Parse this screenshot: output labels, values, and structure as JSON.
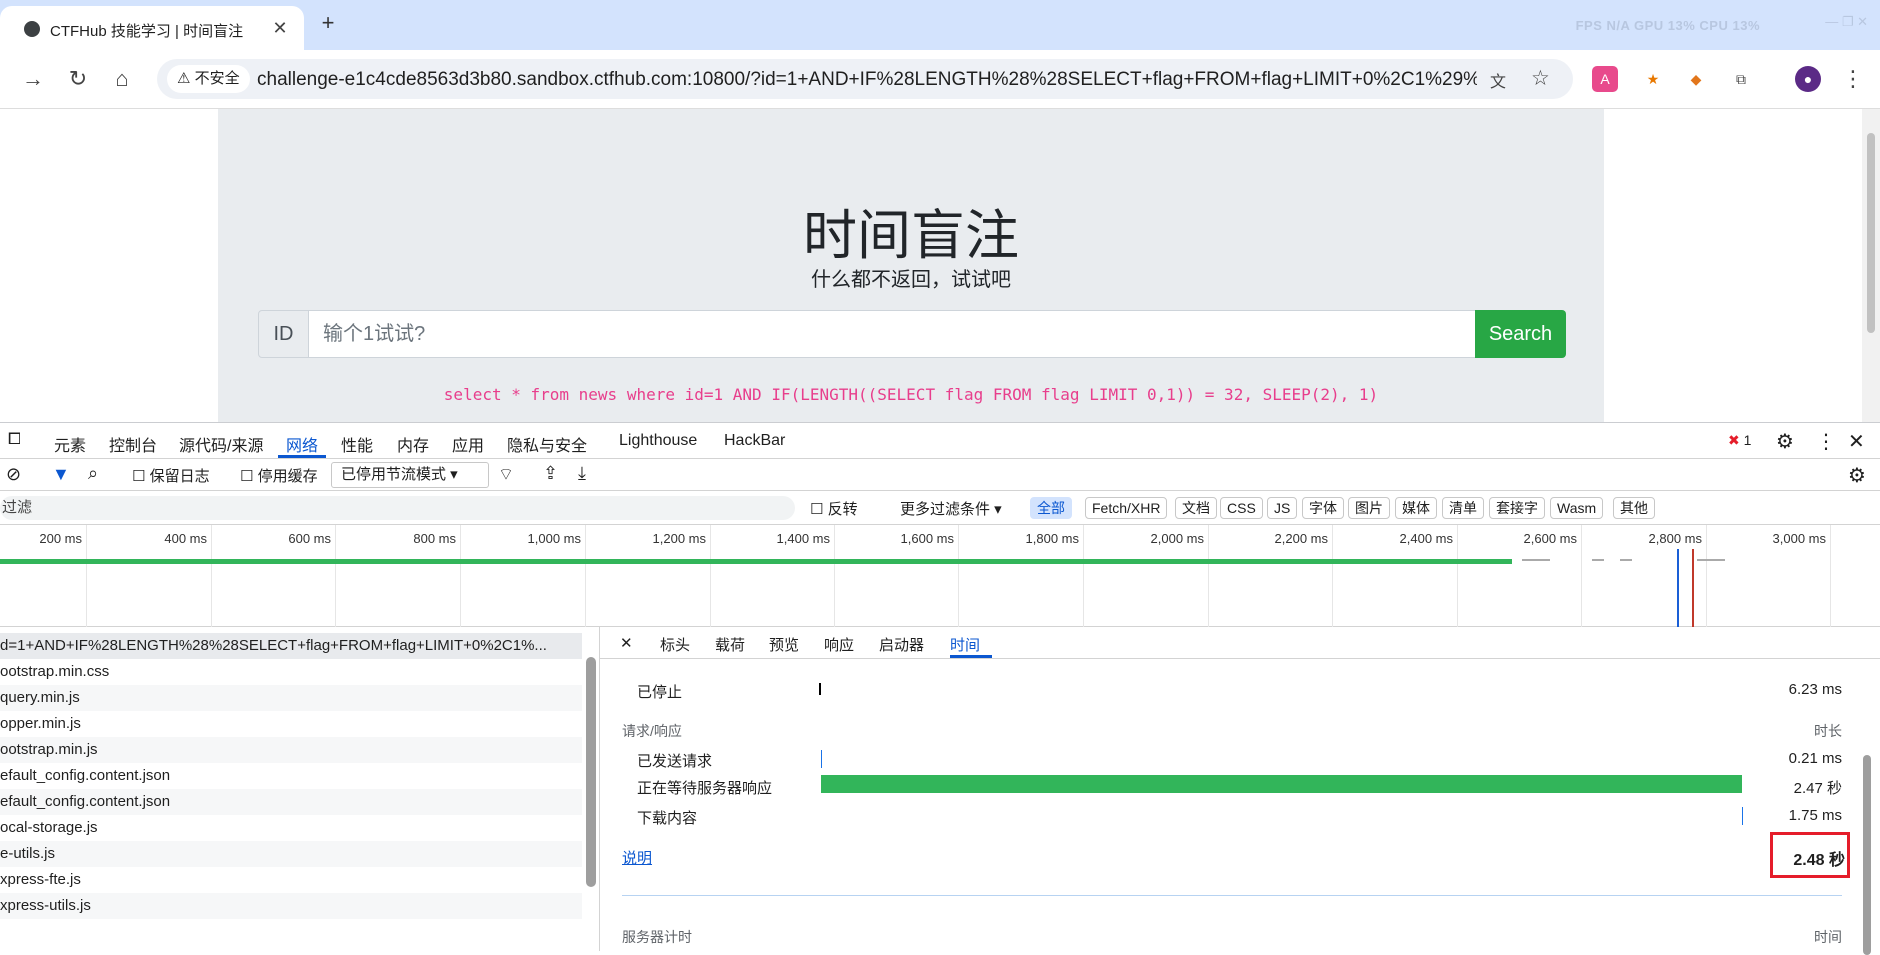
{
  "tab": {
    "title": "CTFHub 技能学习 | 时间盲注",
    "close": "✕",
    "new_tab": "+"
  },
  "perf_overlay": "FPS  N/A    GPU  13%    CPU  13%",
  "window_controls": "—   ❐   ✕",
  "toolbar": {
    "back": "←",
    "forward": "→",
    "reload": "↻",
    "home": "⌂",
    "insecure_label": "不安全",
    "url": "challenge-e1c4cde8563d3b80.sandbox.ctfhub.com:10800/?id=1+AND+IF%28LENGTH%28%28SELECT+flag+FROM+flag+LIMIT+0%2C1%29%2...",
    "menu": "⋮"
  },
  "page": {
    "title": "时间盲注",
    "subtitle": "什么都不返回，试试吧",
    "id_label": "ID",
    "input_placeholder": "输个1试试?",
    "search_label": "Search",
    "sql": "select * from news where id=1 AND IF(LENGTH((SELECT flag FROM flag LIMIT 0,1)) = 32, SLEEP(2), 1)"
  },
  "devtools": {
    "tabs": [
      "元素",
      "控制台",
      "源代码/来源",
      "网络",
      "性能",
      "内存",
      "应用",
      "隐私与安全",
      "Lighthouse",
      "HackBar"
    ],
    "error_count": "1",
    "toolbar": {
      "preserve_log": "保留日志",
      "disable_cache": "停用缓存",
      "throttle": "已停用节流模式"
    },
    "filter": {
      "placeholder": "过滤",
      "invert": "反转",
      "more_filters": "更多过滤条件 ▾",
      "types": [
        "全部",
        "Fetch/XHR",
        "文档",
        "CSS",
        "JS",
        "字体",
        "图片",
        "媒体",
        "清单",
        "套接字",
        "Wasm",
        "其他"
      ]
    },
    "ticks": [
      "200 ms",
      "400 ms",
      "600 ms",
      "800 ms",
      "1,000 ms",
      "1,200 ms",
      "1,400 ms",
      "1,600 ms",
      "1,800 ms",
      "2,000 ms",
      "2,200 ms",
      "2,400 ms",
      "2,600 ms",
      "2,800 ms",
      "3,000 ms"
    ],
    "requests": [
      "d=1+AND+IF%28LENGTH%28%28SELECT+flag+FROM+flag+LIMIT+0%2C1%...",
      "ootstrap.min.css",
      "query.min.js",
      "opper.min.js",
      "ootstrap.min.js",
      "efault_config.content.json",
      "efault_config.content.json",
      "ocal-storage.js",
      "e-utils.js",
      "xpress-fte.js",
      "xpress-utils.js"
    ],
    "timing": {
      "tabs": [
        "标头",
        "载荷",
        "预览",
        "响应",
        "启动器",
        "时间"
      ],
      "stalled_label": "已停止",
      "stalled_value": "6.23 ms",
      "section_label": "请求/响应",
      "duration_header": "时长",
      "sent_label": "已发送请求",
      "sent_value": "0.21 ms",
      "waiting_label": "正在等待服务器响应",
      "waiting_value": "2.47 秒",
      "download_label": "下载内容",
      "download_value": "1.75 ms",
      "explain_link": "说明",
      "total_value": "2.48 秒",
      "server_timing_label": "服务器计时",
      "time_header": "时间"
    }
  },
  "colors": {
    "accent": "#0b57d0",
    "green": "#32b55a",
    "highlight": "#e51d2a",
    "sql": "#e83e8c"
  }
}
